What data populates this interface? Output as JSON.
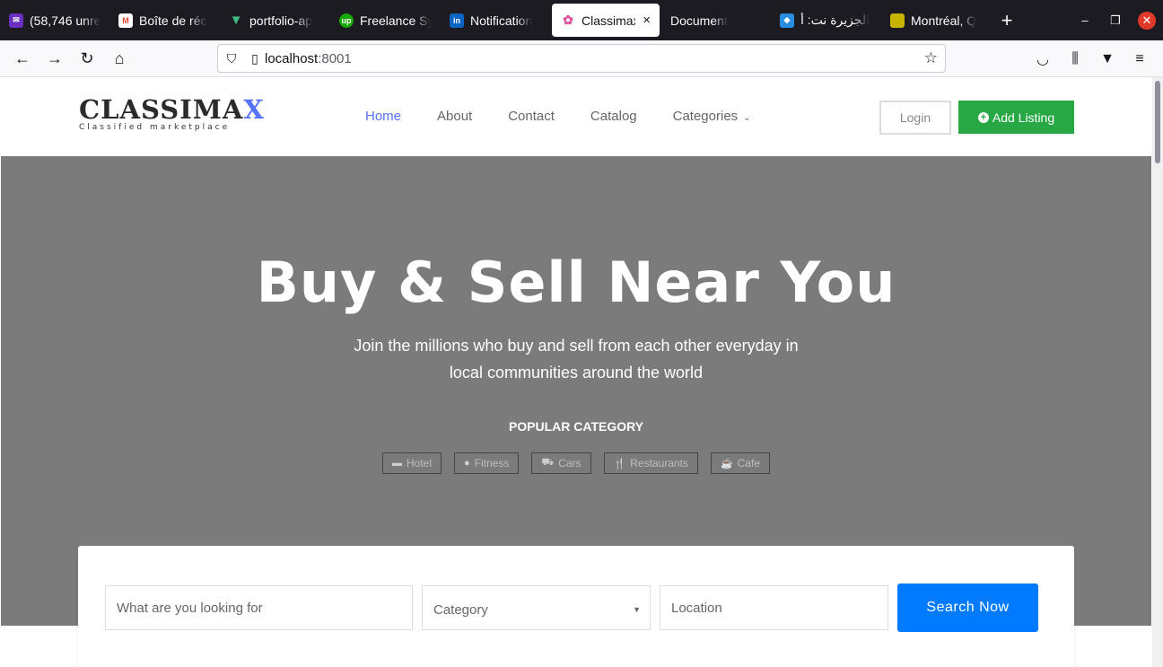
{
  "browser": {
    "tabs": [
      {
        "title": "(58,746 unre",
        "icon": "mail-icon",
        "color": "#6b2fbf"
      },
      {
        "title": "Boîte de réc",
        "icon": "gmail-icon",
        "color": "#ea4335"
      },
      {
        "title": "portfolio-ap",
        "icon": "vue-icon",
        "color": "#41b883"
      },
      {
        "title": "Freelance Sy",
        "icon": "upwork-icon",
        "color": "#14a800"
      },
      {
        "title": "Notification",
        "icon": "linkedin-icon",
        "color": "#0a66c2"
      },
      {
        "title": "Classimax",
        "icon": "lotus-icon",
        "color": "#e0529c",
        "active": true
      },
      {
        "title": "Document",
        "icon": "",
        "color": ""
      },
      {
        "title": "الجزيرة نت: أ",
        "icon": "aljazeera-icon",
        "color": "#2a8ee0"
      },
      {
        "title": "Montréal, Q",
        "icon": "weather-icon",
        "color": "#c8b400"
      }
    ],
    "url_host": "localhost",
    "url_port": ":8001"
  },
  "header": {
    "logo_main": "CLASSIMA",
    "logo_x": "X",
    "logo_tagline": "Classified marketplace",
    "menu": {
      "home": "Home",
      "about": "About",
      "contact": "Contact",
      "catalog": "Catalog",
      "categories": "Categories"
    },
    "login": "Login",
    "add_listing": "Add Listing"
  },
  "hero": {
    "title": "Buy & Sell Near You",
    "subtitle": "Join the millions who buy and sell from each other everyday in local communities around the world",
    "popular_heading": "POPULAR CATEGORY",
    "categories": {
      "hotel": "Hotel",
      "fitness": "Fitness",
      "cars": "Cars",
      "restaurants": "Restaurants",
      "cafe": "Cafe"
    }
  },
  "search": {
    "keyword_placeholder": "What are you looking for",
    "category_selected": "Category",
    "location_placeholder": "Location",
    "button": "Search Now"
  }
}
